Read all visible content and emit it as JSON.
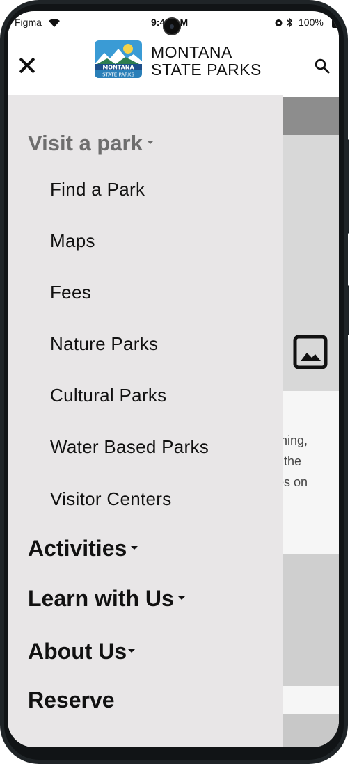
{
  "status_bar": {
    "carrier": "Figma",
    "time": "9:41 AM",
    "battery": "100%",
    "icons": [
      "wifi-icon",
      "alarm-icon",
      "bluetooth-icon",
      "battery-icon"
    ]
  },
  "header": {
    "brand_line1": "MONTANA",
    "brand_line2": "STATE PARKS",
    "logo_text_1": "MONTANA",
    "logo_text_2": "STATE PARKS",
    "close_icon": "close-icon",
    "search_icon": "search-icon"
  },
  "drawer": {
    "sections": [
      {
        "label": "Visit a park",
        "expanded": true,
        "items": [
          "Find a Park",
          "Maps",
          "Fees",
          "Nature Parks",
          "Cultural Parks",
          "Water Based Parks",
          "Visitor Centers"
        ]
      },
      {
        "label": "Activities",
        "expanded": false
      },
      {
        "label": "Learn with Us",
        "expanded": false
      },
      {
        "label": "About Us",
        "expanded": false
      },
      {
        "label": "Reserve"
      }
    ]
  },
  "background_page": {
    "text_fragments": [
      "ming,",
      "f the",
      "es on"
    ],
    "image_placeholder_icon": "image-icon"
  },
  "colors": {
    "drawer_bg": "#e8e6e7",
    "active_section": "#6e6e6e",
    "text": "#111111",
    "logo_blue": "#2a7fb8",
    "logo_green": "#2e8b57"
  }
}
